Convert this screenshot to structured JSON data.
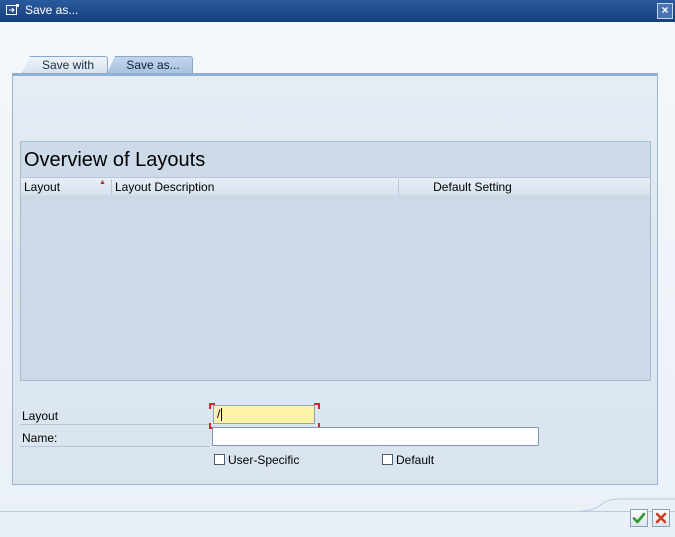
{
  "window": {
    "title": "Save as...",
    "close_symbol": "×",
    "icon": "save-as-window-icon"
  },
  "tabs": [
    {
      "label": "Save with",
      "active": false
    },
    {
      "label": "Save as...",
      "active": true
    }
  ],
  "overview": {
    "title": "Overview of Layouts",
    "columns": [
      "Layout",
      "Layout Description",
      "Default Setting"
    ],
    "sort_indicator": "▲",
    "rows": []
  },
  "form": {
    "layout_label": "Layout",
    "layout_value": "/",
    "name_label": "Name:",
    "name_value": "",
    "user_specific_label": "User-Specific",
    "user_specific_checked": false,
    "default_label": "Default",
    "default_checked": false
  },
  "buttons": {
    "ok_icon": "checkmark-icon",
    "cancel_icon": "cancel-x-icon"
  },
  "colors": {
    "title_bar": "#1f4e8f",
    "input_highlight": "#fdf3a6",
    "ok_green": "#2f9a2f",
    "cancel_red": "#d23b1f"
  }
}
